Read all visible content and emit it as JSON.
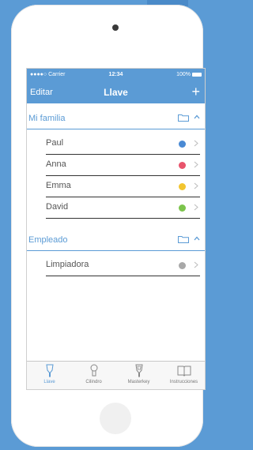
{
  "status_bar": {
    "carrier": "●●●●○ Carrier",
    "time": "12:34",
    "battery": "100%"
  },
  "navbar": {
    "left_label": "Editar",
    "title": "Llave",
    "add_label": "+"
  },
  "groups": [
    {
      "name": "Mi familia",
      "members": [
        {
          "name": "Paul",
          "color": "#4a8ad4"
        },
        {
          "name": "Anna",
          "color": "#e8546c"
        },
        {
          "name": "Emma",
          "color": "#f2c530"
        },
        {
          "name": "David",
          "color": "#7cc44c"
        }
      ]
    },
    {
      "name": "Empleado",
      "members": [
        {
          "name": "Limpiadora",
          "color": "#a8a8a8"
        }
      ]
    }
  ],
  "tabs": [
    {
      "label": "Llave",
      "icon": "key-icon",
      "active": true
    },
    {
      "label": "Cilindro",
      "icon": "cylinder-icon",
      "active": false
    },
    {
      "label": "Masterkey",
      "icon": "masterkey-icon",
      "active": false
    },
    {
      "label": "Instrucciones",
      "icon": "book-icon",
      "active": false
    }
  ]
}
